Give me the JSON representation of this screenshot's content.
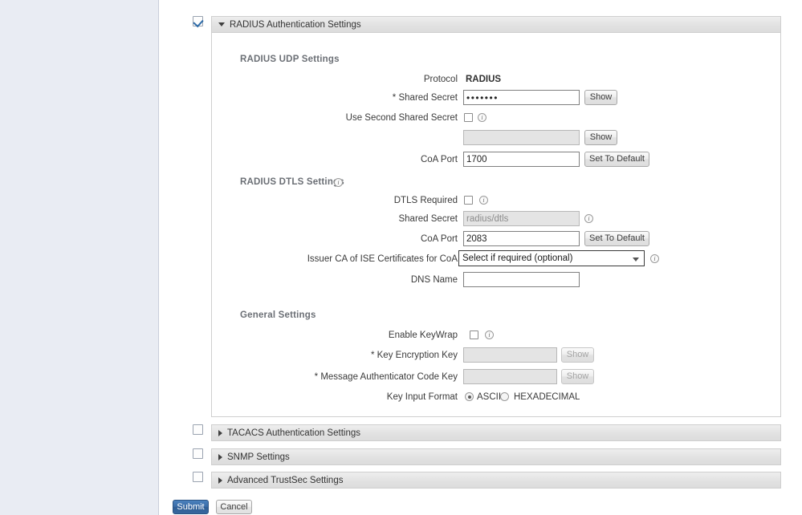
{
  "sections": {
    "radius": {
      "title": "RADIUS Authentication Settings",
      "checked": true,
      "expanded": true,
      "groups": {
        "udp": {
          "title": "RADIUS UDP Settings",
          "protocol_label": "Protocol",
          "protocol_value": "RADIUS",
          "shared_secret_label": "Shared Secret",
          "shared_secret_required": "*",
          "shared_secret_value": "•••••••",
          "shared_secret_show": "Show",
          "use_second_label": "Use Second Shared Secret",
          "use_second_checked": false,
          "second_secret_value": "",
          "second_secret_show": "Show",
          "coa_port_label": "CoA Port",
          "coa_port_value": "1700",
          "coa_port_default_btn": "Set To Default"
        },
        "dtls": {
          "title": "RADIUS DTLS Settings",
          "dtls_required_label": "DTLS Required",
          "dtls_required_checked": false,
          "shared_secret_label": "Shared Secret",
          "shared_secret_value": "radius/dtls",
          "coa_port_label": "CoA Port",
          "coa_port_value": "2083",
          "coa_port_default_btn": "Set To Default",
          "issuer_ca_label": "Issuer CA of ISE Certificates for CoA",
          "issuer_ca_value": "Select if required (optional)",
          "dns_name_label": "DNS Name",
          "dns_name_value": ""
        },
        "general": {
          "title": "General Settings",
          "keywrap_label": "Enable KeyWrap",
          "keywrap_checked": false,
          "kek_label": "Key Encryption Key",
          "kek_required": "*",
          "kek_value": "",
          "kek_show": "Show",
          "mack_label": "Message Authenticator Code Key",
          "mack_required": "*",
          "mack_value": "",
          "mack_show": "Show",
          "key_format_label": "Key Input Format",
          "key_format_options": [
            "ASCII",
            "HEXADECIMAL"
          ],
          "key_format_selected": "ASCII"
        }
      }
    },
    "tacacs": {
      "title": "TACACS Authentication Settings",
      "checked": false,
      "expanded": false
    },
    "snmp": {
      "title": "SNMP Settings",
      "checked": false,
      "expanded": false
    },
    "trustsec": {
      "title": "Advanced TrustSec Settings",
      "checked": false,
      "expanded": false
    }
  },
  "footer": {
    "submit_label": "Submit",
    "cancel_label": "Cancel"
  },
  "icons": {
    "info": "i"
  }
}
